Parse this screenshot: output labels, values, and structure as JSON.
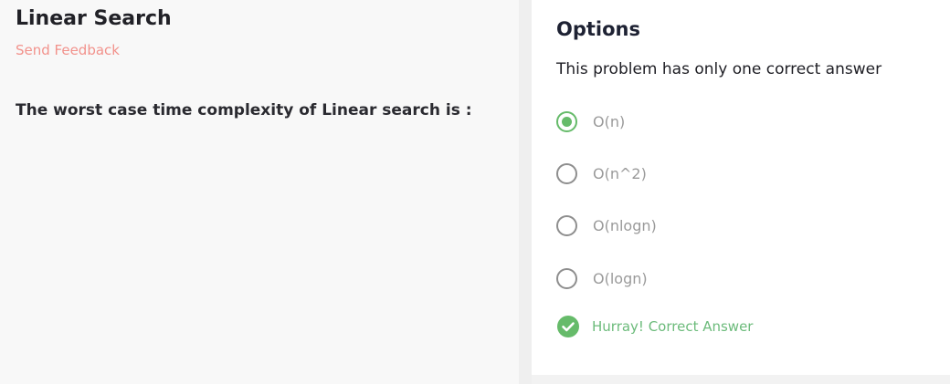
{
  "problem": {
    "title": "Linear Search",
    "feedback_label": "Send Feedback",
    "question": "The worst case time complexity of Linear search is :"
  },
  "options_panel": {
    "heading": "Options",
    "instruction": "This problem has only one correct answer",
    "options": [
      {
        "label": "O(n)",
        "selected": true
      },
      {
        "label": "O(n^2)",
        "selected": false
      },
      {
        "label": "O(nlogn)",
        "selected": false
      },
      {
        "label": "O(logn)",
        "selected": false
      }
    ],
    "result": {
      "icon": "check-circle-icon",
      "message": "Hurray! Correct Answer"
    }
  },
  "colors": {
    "accent_green": "#66bb6a",
    "feedback_pink": "#f2928c",
    "panel_bg": "#ffffff",
    "left_bg": "#f8f8f8"
  }
}
